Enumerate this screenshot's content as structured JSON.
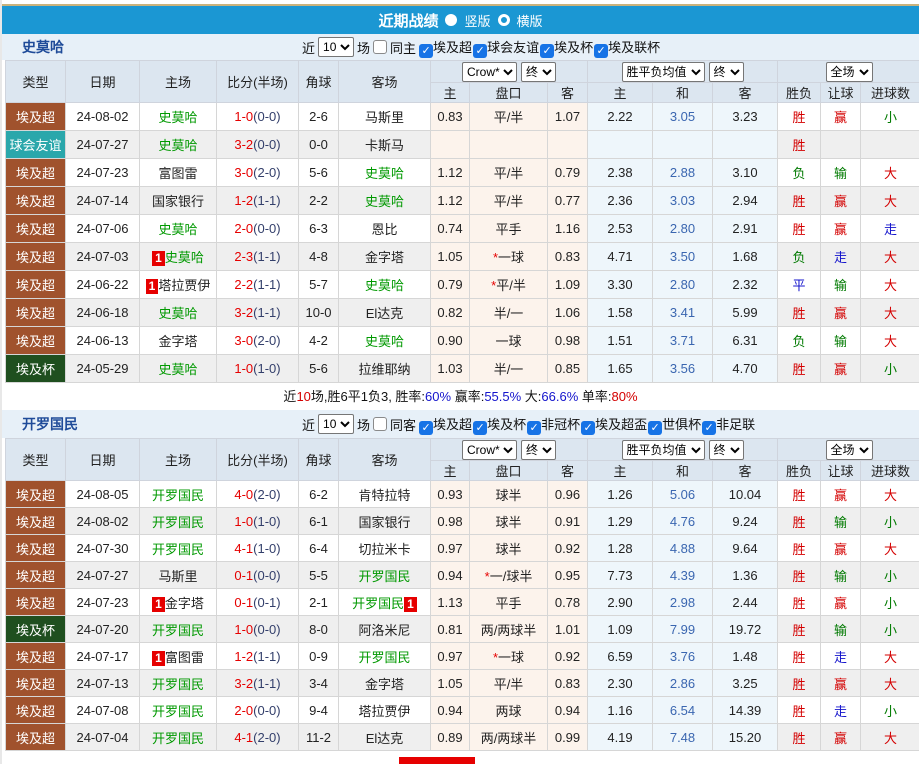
{
  "title_bar": {
    "title": "近期战绩",
    "modes": [
      {
        "label": "竖版",
        "selected": true
      },
      {
        "label": "横版",
        "selected": false
      }
    ]
  },
  "header": {
    "columns": [
      "类型",
      "日期",
      "主场",
      "比分(半场)",
      "角球",
      "客场"
    ],
    "odds_select": "Crow*",
    "odds_final_select": "终",
    "odds_sub": [
      "主",
      "盘口",
      "客"
    ],
    "avg_select": "胜平负均值",
    "avg_final_select": "终",
    "avg_sub": [
      "主",
      "和",
      "客"
    ],
    "scope_select": "全场",
    "result_sub": [
      "胜负",
      "让球",
      "进球数"
    ]
  },
  "colors": {
    "title_bar_blue": "#1b97d3",
    "league_brown": "#a0522d",
    "friendly_teal": "#2aa7ab",
    "cup_dark_green": "#1f4f1f",
    "focal_team_green": "#009900",
    "score_red": "#e60000",
    "half_navy": "#333f6b",
    "avg_draw_blue": "#3a66b0",
    "win_red": "#d40000",
    "lose_green": "#007a00",
    "draw_blue": "#1414cc"
  },
  "sections": [
    {
      "team": "史莫哈",
      "filter": {
        "near": "近",
        "count": "10",
        "unit": "场",
        "same_label": "同主",
        "same_checked": false,
        "comps": [
          "埃及超",
          "球会友谊",
          "埃及杯",
          "埃及联杯"
        ]
      },
      "rows": [
        {
          "type": "埃及超",
          "tc": "brown",
          "date": "24-08-02",
          "home": {
            "name": "史莫哈",
            "focal": true
          },
          "score": "1-0",
          "half": "(0-0)",
          "corner": "2-6",
          "away": {
            "name": "马斯里",
            "focal": false
          },
          "odds": [
            "0.83",
            "平/半",
            "1.07"
          ],
          "avg": [
            "2.22",
            "3.05",
            "3.23"
          ],
          "res": [
            [
              "胜",
              "r"
            ],
            [
              "赢",
              "r"
            ],
            [
              "小",
              "g"
            ]
          ]
        },
        {
          "type": "球会友谊",
          "tc": "teal",
          "date": "24-07-27",
          "home": {
            "name": "史莫哈",
            "focal": true
          },
          "score": "3-2",
          "half": "(0-0)",
          "corner": "0-0",
          "away": {
            "name": "卡斯马",
            "focal": false
          },
          "odds": [
            "",
            "",
            ""
          ],
          "avg": [
            "",
            "",
            ""
          ],
          "res": [
            [
              "胜",
              "r"
            ],
            [
              "",
              ""
            ],
            [
              "",
              ""
            ]
          ]
        },
        {
          "type": "埃及超",
          "tc": "brown",
          "date": "24-07-23",
          "home": {
            "name": "富图雷",
            "focal": false
          },
          "score": "3-0",
          "half": "(2-0)",
          "corner": "5-6",
          "away": {
            "name": "史莫哈",
            "focal": true
          },
          "odds": [
            "1.12",
            "平/半",
            "0.79"
          ],
          "avg": [
            "2.38",
            "2.88",
            "3.10"
          ],
          "res": [
            [
              "负",
              "g"
            ],
            [
              "输",
              "g"
            ],
            [
              "大",
              "r"
            ]
          ]
        },
        {
          "type": "埃及超",
          "tc": "brown",
          "date": "24-07-14",
          "home": {
            "name": "国家银行",
            "focal": false
          },
          "score": "1-2",
          "half": "(1-1)",
          "corner": "2-2",
          "away": {
            "name": "史莫哈",
            "focal": true
          },
          "odds": [
            "1.12",
            "平/半",
            "0.77"
          ],
          "avg": [
            "2.36",
            "3.03",
            "2.94"
          ],
          "res": [
            [
              "胜",
              "r"
            ],
            [
              "赢",
              "r"
            ],
            [
              "大",
              "r"
            ]
          ]
        },
        {
          "type": "埃及超",
          "tc": "brown",
          "date": "24-07-06",
          "home": {
            "name": "史莫哈",
            "focal": true
          },
          "score": "2-0",
          "half": "(0-0)",
          "corner": "6-3",
          "away": {
            "name": "恩比",
            "focal": false
          },
          "odds": [
            "0.74",
            "平手",
            "1.16"
          ],
          "avg": [
            "2.53",
            "2.80",
            "2.91"
          ],
          "res": [
            [
              "胜",
              "r"
            ],
            [
              "赢",
              "r"
            ],
            [
              "走",
              "b"
            ]
          ]
        },
        {
          "type": "埃及超",
          "tc": "brown",
          "date": "24-07-03",
          "home": {
            "name": "史莫哈",
            "focal": true,
            "badge": "1",
            "badge_pos": "before"
          },
          "score": "2-3",
          "half": "(1-1)",
          "corner": "4-8",
          "away": {
            "name": "金字塔",
            "focal": false
          },
          "odds": [
            "1.05",
            "*一球",
            "0.83"
          ],
          "avg": [
            "4.71",
            "3.50",
            "1.68"
          ],
          "res": [
            [
              "负",
              "g"
            ],
            [
              "走",
              "b"
            ],
            [
              "大",
              "r"
            ]
          ]
        },
        {
          "type": "埃及超",
          "tc": "brown",
          "date": "24-06-22",
          "home": {
            "name": "塔拉贾伊",
            "focal": false,
            "badge": "1",
            "badge_pos": "before"
          },
          "score": "2-2",
          "half": "(1-1)",
          "corner": "5-7",
          "away": {
            "name": "史莫哈",
            "focal": true
          },
          "odds": [
            "0.79",
            "*平/半",
            "1.09"
          ],
          "avg": [
            "3.30",
            "2.80",
            "2.32"
          ],
          "res": [
            [
              "平",
              "b"
            ],
            [
              "输",
              "g"
            ],
            [
              "大",
              "r"
            ]
          ]
        },
        {
          "type": "埃及超",
          "tc": "brown",
          "date": "24-06-18",
          "home": {
            "name": "史莫哈",
            "focal": true
          },
          "score": "3-2",
          "half": "(1-1)",
          "corner": "10-0",
          "away": {
            "name": "El达克",
            "focal": false
          },
          "odds": [
            "0.82",
            "半/一",
            "1.06"
          ],
          "avg": [
            "1.58",
            "3.41",
            "5.99"
          ],
          "res": [
            [
              "胜",
              "r"
            ],
            [
              "赢",
              "r"
            ],
            [
              "大",
              "r"
            ]
          ]
        },
        {
          "type": "埃及超",
          "tc": "brown",
          "date": "24-06-13",
          "home": {
            "name": "金字塔",
            "focal": false
          },
          "score": "3-0",
          "half": "(2-0)",
          "corner": "4-2",
          "away": {
            "name": "史莫哈",
            "focal": true
          },
          "odds": [
            "0.90",
            "一球",
            "0.98"
          ],
          "avg": [
            "1.51",
            "3.71",
            "6.31"
          ],
          "res": [
            [
              "负",
              "g"
            ],
            [
              "输",
              "g"
            ],
            [
              "大",
              "r"
            ]
          ]
        },
        {
          "type": "埃及杯",
          "tc": "dgreen",
          "date": "24-05-29",
          "home": {
            "name": "史莫哈",
            "focal": true
          },
          "score": "1-0",
          "half": "(1-0)",
          "corner": "5-6",
          "away": {
            "name": "拉维耶纳",
            "focal": false
          },
          "odds": [
            "1.03",
            "半/一",
            "0.85"
          ],
          "avg": [
            "1.65",
            "3.56",
            "4.70"
          ],
          "res": [
            [
              "胜",
              "r"
            ],
            [
              "赢",
              "r"
            ],
            [
              "小",
              "g"
            ]
          ]
        }
      ],
      "summary": [
        [
          "近",
          "k"
        ],
        [
          "10",
          "r"
        ],
        [
          "场,胜6平1负3, 胜率:",
          "k"
        ],
        [
          "60%",
          "b"
        ],
        [
          " 赢率:",
          "k"
        ],
        [
          "55.5%",
          "b"
        ],
        [
          " 大:",
          "k"
        ],
        [
          "66.6%",
          "b"
        ],
        [
          " 单率:",
          "k"
        ],
        [
          "80%",
          "r"
        ]
      ]
    },
    {
      "team": "开罗国民",
      "filter": {
        "near": "近",
        "count": "10",
        "unit": "场",
        "same_label": "同客",
        "same_checked": false,
        "comps": [
          "埃及超",
          "埃及杯",
          "非冠杯",
          "埃及超盃",
          "世俱杯",
          "非足联"
        ]
      },
      "rows": [
        {
          "type": "埃及超",
          "tc": "brown",
          "date": "24-08-05",
          "home": {
            "name": "开罗国民",
            "focal": true
          },
          "score": "4-0",
          "half": "(2-0)",
          "corner": "6-2",
          "away": {
            "name": "肯特拉特",
            "focal": false
          },
          "odds": [
            "0.93",
            "球半",
            "0.96"
          ],
          "avg": [
            "1.26",
            "5.06",
            "10.04"
          ],
          "res": [
            [
              "胜",
              "r"
            ],
            [
              "赢",
              "r"
            ],
            [
              "大",
              "r"
            ]
          ]
        },
        {
          "type": "埃及超",
          "tc": "brown",
          "date": "24-08-02",
          "home": {
            "name": "开罗国民",
            "focal": true
          },
          "score": "1-0",
          "half": "(1-0)",
          "corner": "6-1",
          "away": {
            "name": "国家银行",
            "focal": false
          },
          "odds": [
            "0.98",
            "球半",
            "0.91"
          ],
          "avg": [
            "1.29",
            "4.76",
            "9.24"
          ],
          "res": [
            [
              "胜",
              "r"
            ],
            [
              "输",
              "g"
            ],
            [
              "小",
              "g"
            ]
          ]
        },
        {
          "type": "埃及超",
          "tc": "brown",
          "date": "24-07-30",
          "home": {
            "name": "开罗国民",
            "focal": true
          },
          "score": "4-1",
          "half": "(1-0)",
          "corner": "6-4",
          "away": {
            "name": "切拉米卡",
            "focal": false
          },
          "odds": [
            "0.97",
            "球半",
            "0.92"
          ],
          "avg": [
            "1.28",
            "4.88",
            "9.64"
          ],
          "res": [
            [
              "胜",
              "r"
            ],
            [
              "赢",
              "r"
            ],
            [
              "大",
              "r"
            ]
          ]
        },
        {
          "type": "埃及超",
          "tc": "brown",
          "date": "24-07-27",
          "home": {
            "name": "马斯里",
            "focal": false
          },
          "score": "0-1",
          "half": "(0-0)",
          "corner": "5-5",
          "away": {
            "name": "开罗国民",
            "focal": true
          },
          "odds": [
            "0.94",
            "*一/球半",
            "0.95"
          ],
          "avg": [
            "7.73",
            "4.39",
            "1.36"
          ],
          "res": [
            [
              "胜",
              "r"
            ],
            [
              "输",
              "g"
            ],
            [
              "小",
              "g"
            ]
          ]
        },
        {
          "type": "埃及超",
          "tc": "brown",
          "date": "24-07-23",
          "home": {
            "name": "金字塔",
            "focal": false,
            "badge": "1",
            "badge_pos": "before"
          },
          "score": "0-1",
          "half": "(0-1)",
          "corner": "2-1",
          "away": {
            "name": "开罗国民",
            "focal": true,
            "badge": "1",
            "badge_pos": "after"
          },
          "odds": [
            "1.13",
            "平手",
            "0.78"
          ],
          "avg": [
            "2.90",
            "2.98",
            "2.44"
          ],
          "res": [
            [
              "胜",
              "r"
            ],
            [
              "赢",
              "r"
            ],
            [
              "小",
              "g"
            ]
          ]
        },
        {
          "type": "埃及杯",
          "tc": "dgreen",
          "date": "24-07-20",
          "home": {
            "name": "开罗国民",
            "focal": true
          },
          "score": "1-0",
          "half": "(0-0)",
          "corner": "8-0",
          "away": {
            "name": "阿洛米尼",
            "focal": false
          },
          "odds": [
            "0.81",
            "两/两球半",
            "1.01"
          ],
          "avg": [
            "1.09",
            "7.99",
            "19.72"
          ],
          "res": [
            [
              "胜",
              "r"
            ],
            [
              "输",
              "g"
            ],
            [
              "小",
              "g"
            ]
          ]
        },
        {
          "type": "埃及超",
          "tc": "brown",
          "date": "24-07-17",
          "home": {
            "name": "富图雷",
            "focal": false,
            "badge": "1",
            "badge_pos": "before"
          },
          "score": "1-2",
          "half": "(1-1)",
          "corner": "0-9",
          "away": {
            "name": "开罗国民",
            "focal": true
          },
          "odds": [
            "0.97",
            "*一球",
            "0.92"
          ],
          "avg": [
            "6.59",
            "3.76",
            "1.48"
          ],
          "res": [
            [
              "胜",
              "r"
            ],
            [
              "走",
              "b"
            ],
            [
              "大",
              "r"
            ]
          ]
        },
        {
          "type": "埃及超",
          "tc": "brown",
          "date": "24-07-13",
          "home": {
            "name": "开罗国民",
            "focal": true
          },
          "score": "3-2",
          "half": "(1-1)",
          "corner": "3-4",
          "away": {
            "name": "金字塔",
            "focal": false
          },
          "odds": [
            "1.05",
            "平/半",
            "0.83"
          ],
          "avg": [
            "2.30",
            "2.86",
            "3.25"
          ],
          "res": [
            [
              "胜",
              "r"
            ],
            [
              "赢",
              "r"
            ],
            [
              "大",
              "r"
            ]
          ]
        },
        {
          "type": "埃及超",
          "tc": "brown",
          "date": "24-07-08",
          "home": {
            "name": "开罗国民",
            "focal": true
          },
          "score": "2-0",
          "half": "(0-0)",
          "corner": "9-4",
          "away": {
            "name": "塔拉贾伊",
            "focal": false
          },
          "odds": [
            "0.94",
            "两球",
            "0.94"
          ],
          "avg": [
            "1.16",
            "6.54",
            "14.39"
          ],
          "res": [
            [
              "胜",
              "r"
            ],
            [
              "走",
              "b"
            ],
            [
              "小",
              "g"
            ]
          ]
        },
        {
          "type": "埃及超",
          "tc": "brown",
          "date": "24-07-04",
          "home": {
            "name": "开罗国民",
            "focal": true
          },
          "score": "4-1",
          "half": "(2-0)",
          "corner": "11-2",
          "away": {
            "name": "El达克",
            "focal": false
          },
          "odds": [
            "0.89",
            "两/两球半",
            "0.99"
          ],
          "avg": [
            "4.19",
            "7.48",
            "15.20"
          ],
          "res": [
            [
              "胜",
              "r"
            ],
            [
              "赢",
              "r"
            ],
            [
              "大",
              "r"
            ]
          ]
        }
      ],
      "summary": []
    }
  ]
}
